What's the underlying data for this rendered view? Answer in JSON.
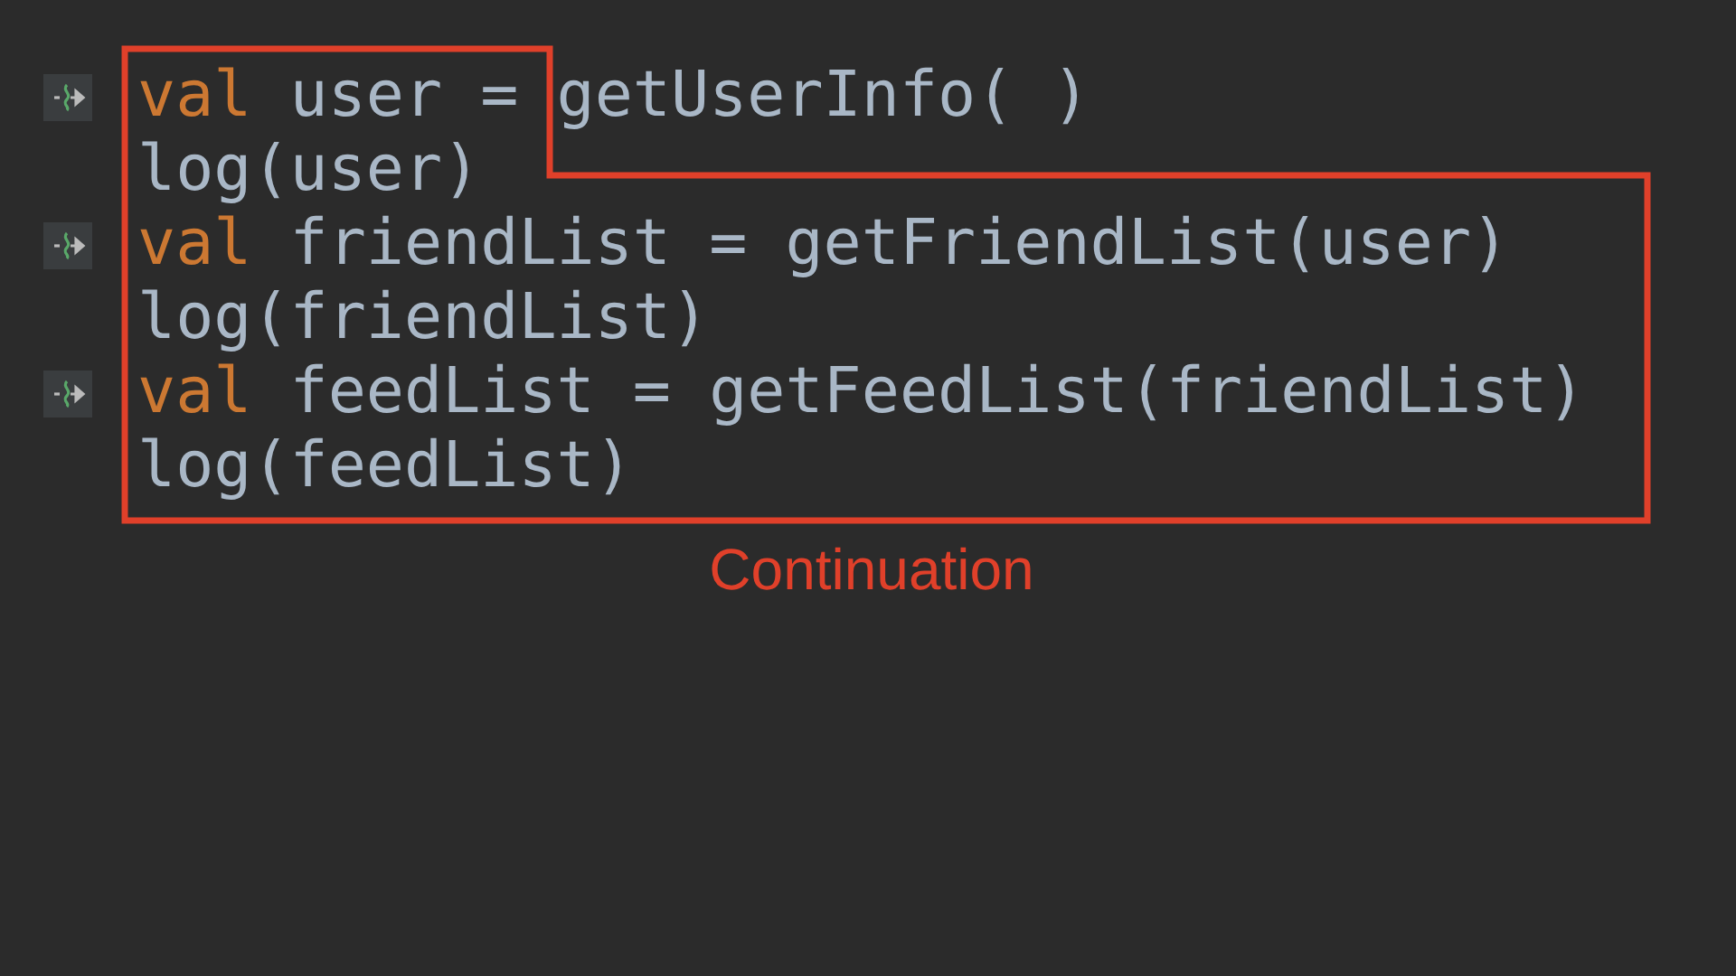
{
  "code_lines": [
    {
      "suspend": true,
      "tokens": [
        {
          "kind": "keyword",
          "text": "val"
        },
        {
          "kind": "plain",
          "text": " user = getUserInfo( )"
        }
      ]
    },
    {
      "suspend": false,
      "tokens": [
        {
          "kind": "plain",
          "text": "log(user)"
        }
      ]
    },
    {
      "suspend": true,
      "tokens": [
        {
          "kind": "keyword",
          "text": "val"
        },
        {
          "kind": "plain",
          "text": " friendList = getFriendList(user)"
        }
      ]
    },
    {
      "suspend": false,
      "tokens": [
        {
          "kind": "plain",
          "text": "log(friendList)"
        }
      ]
    },
    {
      "suspend": true,
      "tokens": [
        {
          "kind": "keyword",
          "text": "val"
        },
        {
          "kind": "plain",
          "text": " feedList = getFeedList(friendList)"
        }
      ]
    },
    {
      "suspend": false,
      "tokens": [
        {
          "kind": "plain",
          "text": "log(feedList)"
        }
      ]
    }
  ],
  "annotation": {
    "label": "Continuation"
  }
}
